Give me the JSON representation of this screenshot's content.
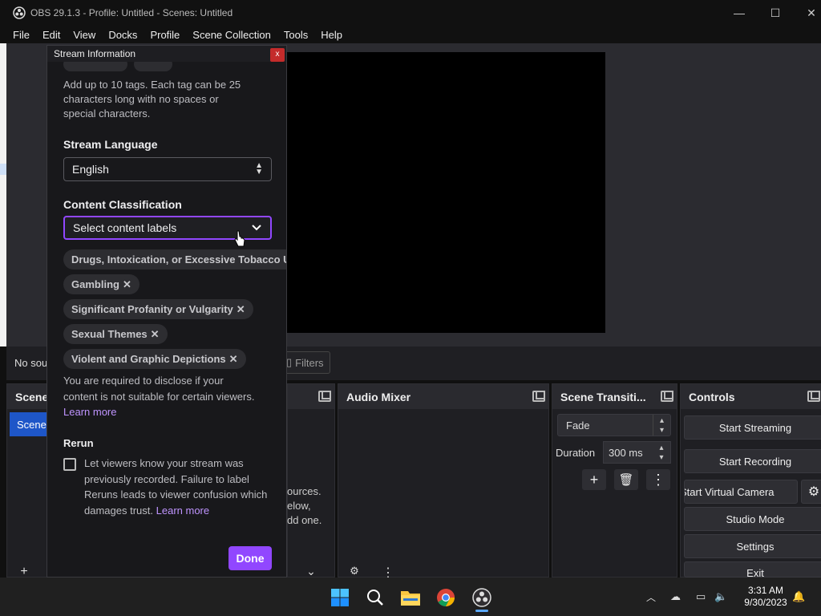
{
  "window": {
    "title": "OBS 29.1.3 - Profile: Untitled - Scenes: Untitled",
    "minimize": "—",
    "maximize": "☐",
    "close": "✕"
  },
  "menu": [
    "File",
    "Edit",
    "View",
    "Docks",
    "Profile",
    "Scene Collection",
    "Tools",
    "Help"
  ],
  "sources_bar": {
    "no_source": "No sou",
    "filters": "Filters"
  },
  "docks": {
    "scenes": {
      "title": "Scene",
      "item": "Scene"
    },
    "sources": {
      "hint_lines": [
        "ources.",
        "elow,",
        "dd one."
      ]
    },
    "audio_mixer": {
      "title": "Audio Mixer"
    },
    "scene_transitions": {
      "title": "Scene Transiti...",
      "transition": "Fade",
      "duration_label": "Duration",
      "duration_value": "300 ms"
    },
    "controls": {
      "title": "Controls",
      "buttons": [
        "Start Streaming",
        "Start Recording",
        "Start Virtual Camera",
        "Studio Mode",
        "Settings",
        "Exit"
      ]
    }
  },
  "dialog": {
    "title": "Stream Information",
    "close": "x",
    "tags_help": [
      "Add up to 10 tags. Each tag can be 25",
      "characters long with no spaces or",
      "special characters."
    ],
    "language_label": "Stream Language",
    "language_value": "English",
    "classification_label": "Content Classification",
    "classification_placeholder": "Select content labels",
    "labels": [
      "Drugs, Intoxication, or Excessive Tobacco Use",
      "Gambling",
      "Significant Profanity or Vulgarity",
      "Sexual Themes",
      "Violent and Graphic Depictions"
    ],
    "disclosure_text": [
      "You are required to disclose if your",
      "content is not suitable for certain viewers."
    ],
    "learn_more": "Learn more",
    "rerun_label": "Rerun",
    "rerun_checked": false,
    "rerun_text": "Let viewers know your stream was previously recorded. Failure to label Reruns leads to viewer confusion which damages trust.",
    "rerun_learn_more": "Learn more",
    "done": "Done"
  },
  "taskbar": {
    "time": "3:31 AM",
    "date": "9/30/2023",
    "icons": [
      "windows-start-icon",
      "search-icon",
      "file-explorer-icon",
      "chrome-icon",
      "obs-icon"
    ]
  },
  "colors": {
    "accent": "#9147ff",
    "link": "#bf94ff",
    "scene_selected": "#1e56c8"
  }
}
